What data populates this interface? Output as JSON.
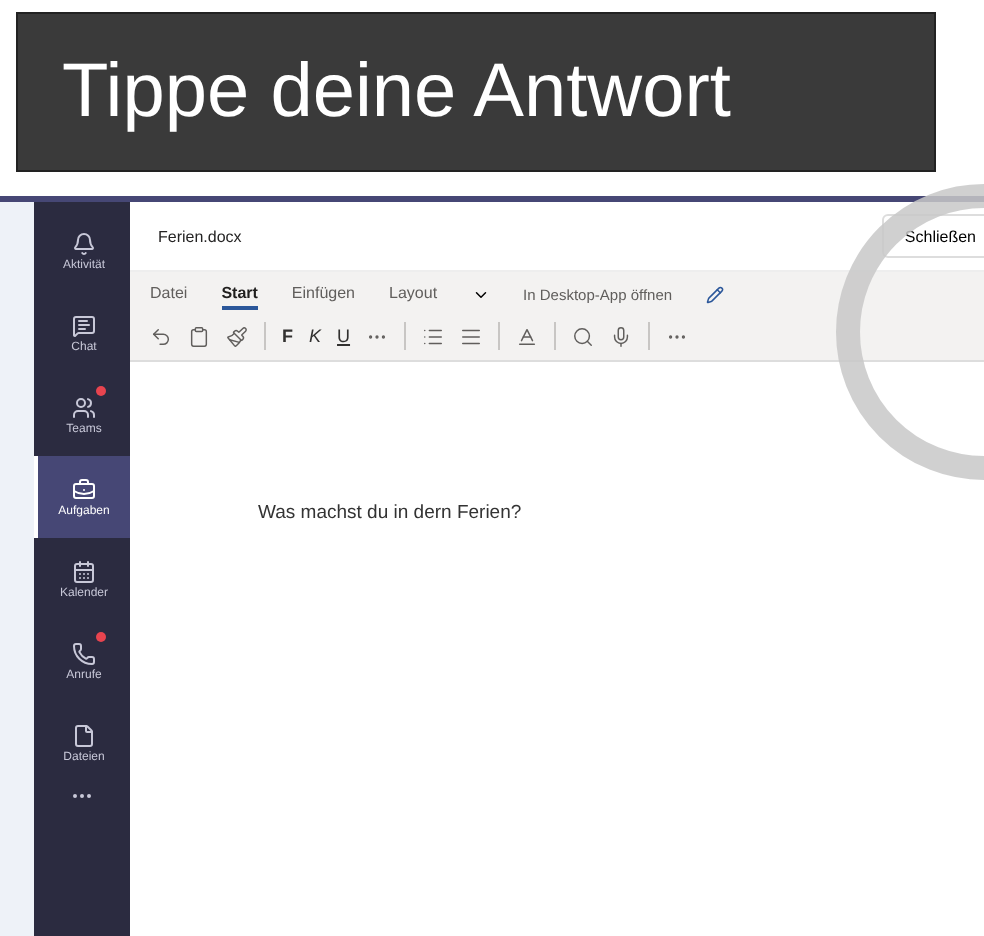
{
  "banner": {
    "title": "Tippe deine Antwort"
  },
  "sidebar": {
    "items": [
      {
        "label": "Aktivität",
        "selected": false,
        "notification": false
      },
      {
        "label": "Chat",
        "selected": false,
        "notification": false
      },
      {
        "label": "Teams",
        "selected": false,
        "notification": true
      },
      {
        "label": "Aufgaben",
        "selected": true,
        "notification": false
      },
      {
        "label": "Kalender",
        "selected": false,
        "notification": false
      },
      {
        "label": "Anrufe",
        "selected": false,
        "notification": true
      },
      {
        "label": "Dateien",
        "selected": false,
        "notification": false
      }
    ]
  },
  "header": {
    "document_name": "Ferien.docx",
    "close_button": "Schließen"
  },
  "ribbon": {
    "tabs": [
      {
        "label": "Datei",
        "selected": false
      },
      {
        "label": "Start",
        "selected": true
      },
      {
        "label": "Einfügen",
        "selected": false
      },
      {
        "label": "Layout",
        "selected": false
      }
    ],
    "open_in_desktop": "In Desktop-App öffnen",
    "format_buttons": [
      "F",
      "K",
      "U"
    ]
  },
  "document": {
    "text": "Was machst du in dern Ferien?"
  }
}
